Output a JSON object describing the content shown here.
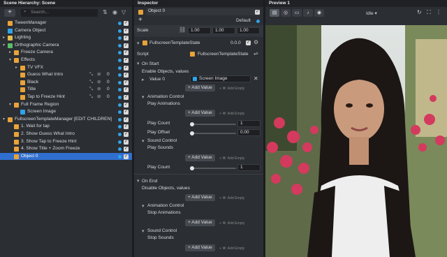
{
  "hierarchy": {
    "title": "Scene Hierarchy: Scene",
    "search_placeholder": "Search...",
    "add_label": "+",
    "rows": [
      {
        "label": "TweenManager",
        "indent": 0,
        "icon": "#e8a33a",
        "arrow": "",
        "sel": false
      },
      {
        "label": "Camera Object",
        "indent": 0,
        "icon": "#2fa3e8",
        "arrow": "",
        "sel": false
      },
      {
        "label": "Lighting",
        "indent": 0,
        "icon": "#e0c050",
        "arrow": "▸",
        "sel": false
      },
      {
        "label": "Orthographic Camera",
        "indent": 0,
        "icon": "#5abf6a",
        "arrow": "▾",
        "sel": false
      },
      {
        "label": "Freeze Camera",
        "indent": 1,
        "icon": "#e8a33a",
        "arrow": "▸",
        "sel": false
      },
      {
        "label": "Effects",
        "indent": 1,
        "icon": "#e8a33a",
        "arrow": "▾",
        "sel": false
      },
      {
        "label": "TV VFX",
        "indent": 2,
        "icon": "#e8a33a",
        "arrow": "▸",
        "sel": false
      },
      {
        "label": "Guess What Intro",
        "indent": 2,
        "icon": "#e8a33a",
        "arrow": "",
        "sel": false,
        "count": "0"
      },
      {
        "label": "Black",
        "indent": 2,
        "icon": "#e8a33a",
        "arrow": "",
        "sel": false,
        "count": "0"
      },
      {
        "label": "Title",
        "indent": 2,
        "icon": "#e8a33a",
        "arrow": "",
        "sel": false,
        "count": "0"
      },
      {
        "label": "Tap to Freeze Hint",
        "indent": 2,
        "icon": "#e8a33a",
        "arrow": "",
        "sel": false,
        "count": "0"
      },
      {
        "label": "Full Frame Region",
        "indent": 1,
        "icon": "#e8a33a",
        "arrow": "▾",
        "sel": false
      },
      {
        "label": "Screen Image",
        "indent": 2,
        "icon": "#2fa3e8",
        "arrow": "",
        "sel": false
      },
      {
        "label": "FullscreenTemplateManager [EDIT CHILDREN]",
        "indent": 0,
        "icon": "#e8a33a",
        "arrow": "▾",
        "sel": false
      },
      {
        "label": "1. Wait for tap",
        "indent": 1,
        "icon": "#e8a33a",
        "arrow": "",
        "sel": false
      },
      {
        "label": "2. Show Guess What Intro",
        "indent": 1,
        "icon": "#e8a33a",
        "arrow": "",
        "sel": false
      },
      {
        "label": "3. Show Tap to Freeze Hint",
        "indent": 1,
        "icon": "#e8a33a",
        "arrow": "",
        "sel": false
      },
      {
        "label": "4. Show Title + Zoom Freeze",
        "indent": 1,
        "icon": "#e8a33a",
        "arrow": "",
        "sel": false
      },
      {
        "label": "Object 0",
        "indent": 1,
        "icon": "#e8a33a",
        "arrow": "",
        "sel": true
      }
    ]
  },
  "inspector": {
    "title": "Inspector",
    "object_name": "Object 0",
    "layer": "Default",
    "add_label": "+",
    "scale_label": "Scale",
    "scale": [
      "1.00",
      "1.00",
      "1.00"
    ],
    "component": "FullscreenTemplateState",
    "version": "0.0.0",
    "script_label": "Script",
    "script_value": "FullscreenTemplateState",
    "on_start": "On Start",
    "enable_objects": "Enable Objects, values",
    "value0": "Value 0",
    "screen_image": "Screen Image",
    "add_value": "+ Add Value",
    "add_empty": "+ ⌘: Add Empty",
    "anim_control": "Animation Control",
    "play_animations": "Play Animations",
    "play_count": "Play Count",
    "play_count_val": "1",
    "play_offset": "Play Offset",
    "play_offset_val": "0.00",
    "sound_control": "Sound Control",
    "play_sounds": "Play Sounds",
    "play_count2_val": "1",
    "on_end": "On End",
    "disable_objects": "Disable Objects, values",
    "stop_animations": "Stop Animations",
    "stop_sounds": "Stop Sounds"
  },
  "preview": {
    "title": "Preview 1",
    "mode": "Idle"
  }
}
